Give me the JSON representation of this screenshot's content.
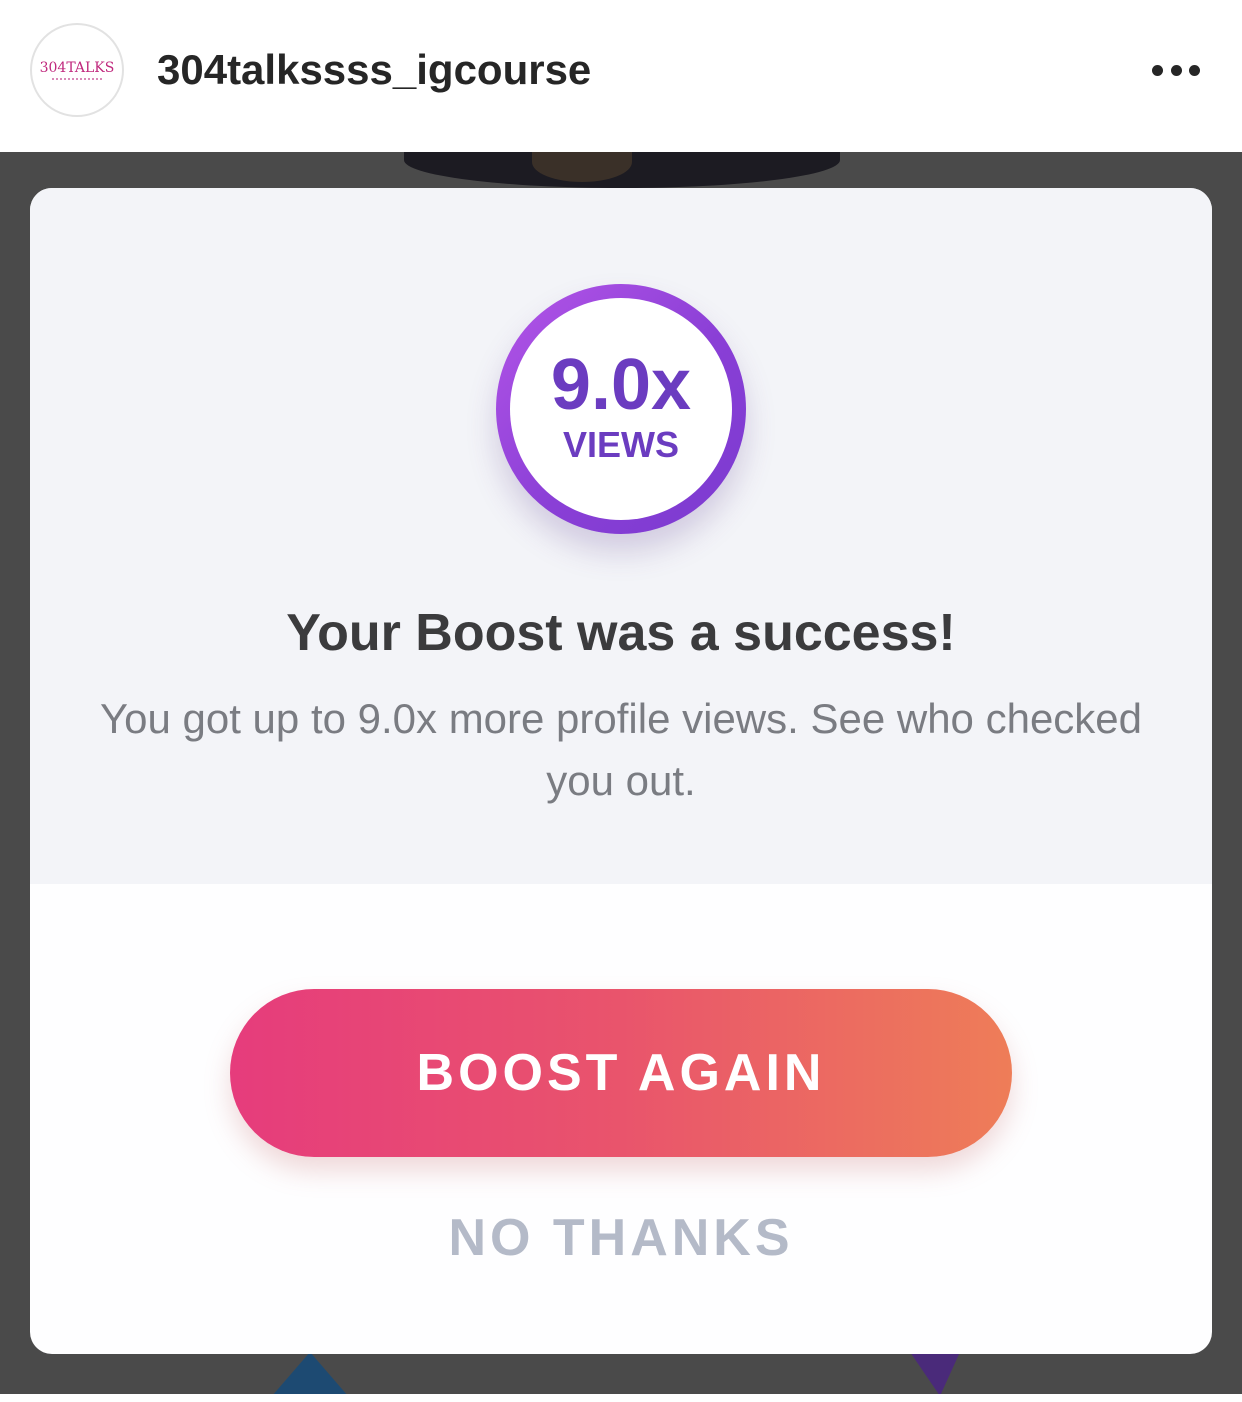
{
  "post_header": {
    "avatar_text": "304TALKS",
    "username": "304talkssss_igcourse",
    "more_icon": "more-horizontal-icon"
  },
  "modal": {
    "badge": {
      "value": "9.0x",
      "label": "VIEWS"
    },
    "title": "Your Boost was a success!",
    "body": "You got up to 9.0x more profile views. See who checked you out.",
    "primary_button": "BOOST AGAIN",
    "secondary_button": "NO THANKS"
  },
  "colors": {
    "badge_ring": "#8a3fd6",
    "badge_text": "#6b3cc0",
    "button_gradient_start": "#e63c7c",
    "button_gradient_end": "#ee7d58",
    "secondary_text": "#b4bac8",
    "overlay": "#4a4a4a"
  }
}
